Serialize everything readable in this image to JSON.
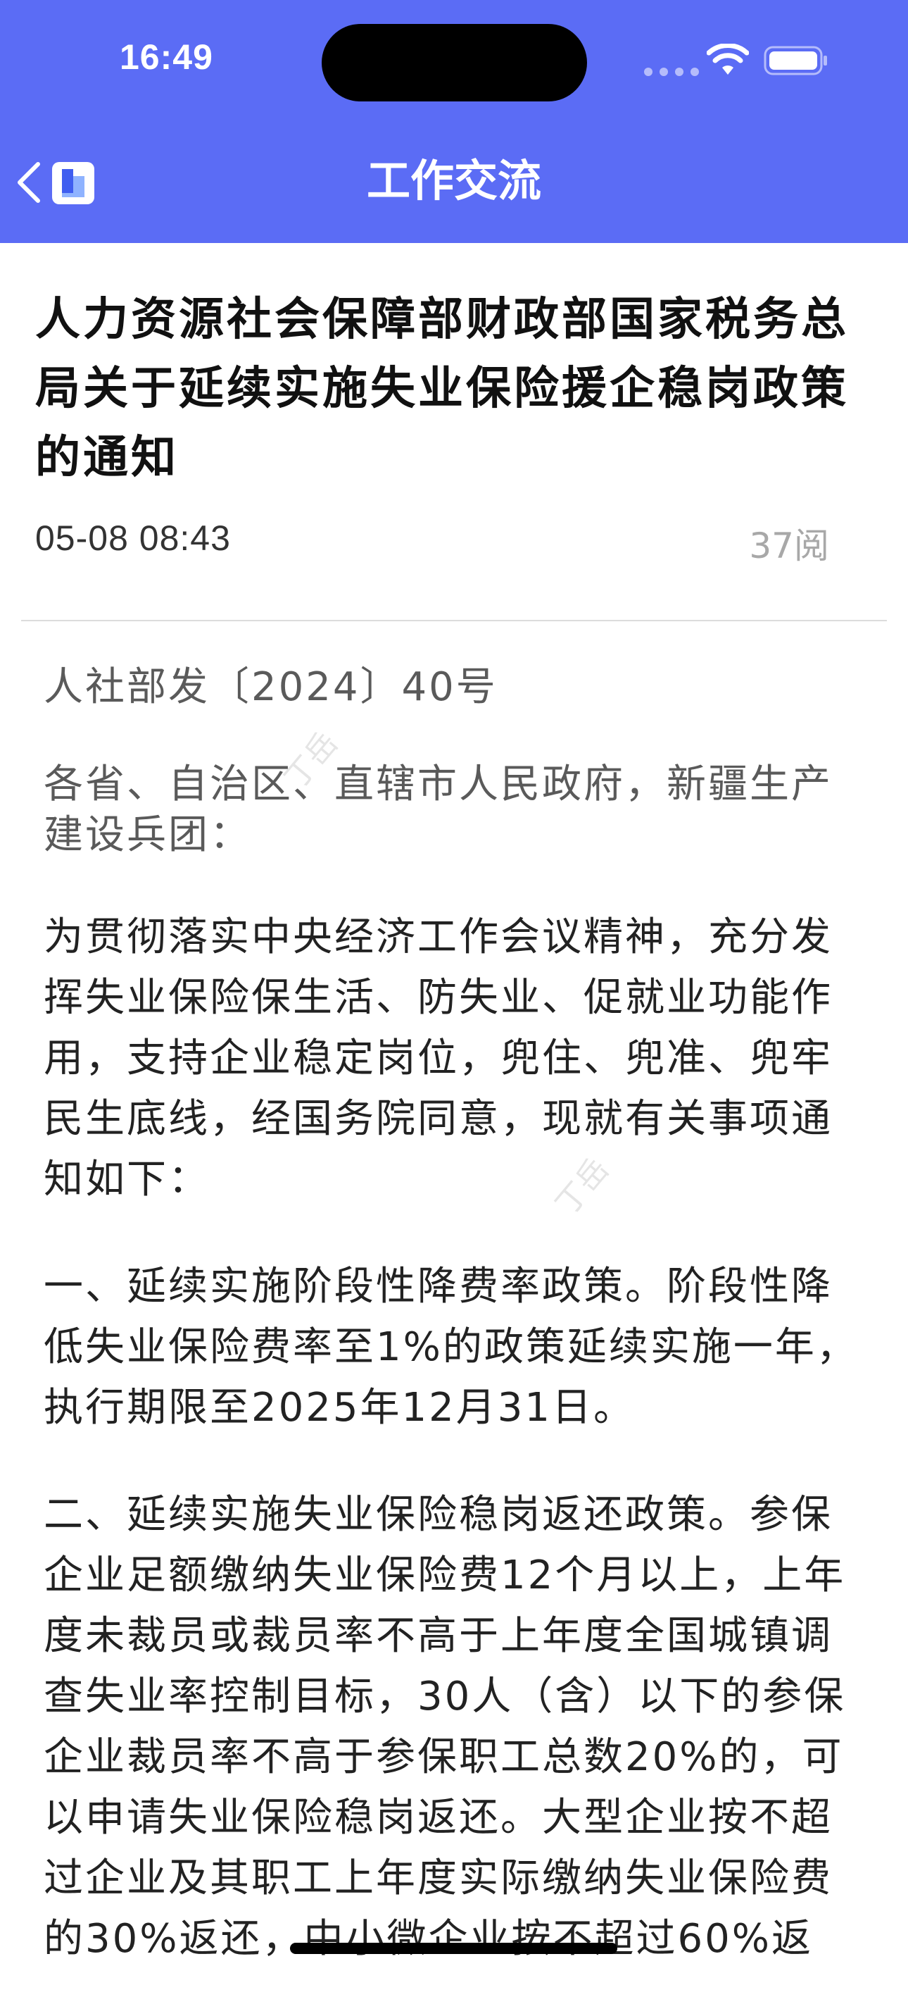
{
  "status_bar": {
    "time": "16:49"
  },
  "nav": {
    "title": "工作交流"
  },
  "article": {
    "title": "人力资源社会保障部财政部国家税务总局关于延续实施失业保险援企稳岗政策的通知",
    "date": "05-08 08:43",
    "reads": "37阅",
    "doc_number": "人社部发〔2024〕40号",
    "addressee": "各省、自治区、直辖市人民政府，新疆生产建设兵团：",
    "paragraphs": [
      "为贯彻落实中央经济工作会议精神，充分发挥失业保险保生活、防失业、促就业功能作用，支持企业稳定岗位，兜住、兜准、兜牢民生底线，经国务院同意，现就有关事项通知如下：",
      "一、延续实施阶段性降费率政策。阶段性降低失业保险费率至1%的政策延续实施一年，执行期限至2025年12月31日。",
      "二、延续实施失业保险稳岗返还政策。参保企业足额缴纳失业保险费12个月以上，上年度未裁员或裁员率不高于上年度全国城镇调查失业率控制目标，30人（含）以下的参保企业裁员率不高于参保职工总数20%的，可以申请失业保险稳岗返还。大型企业按不超过企业及其职工上年度实际缴纳失业保险费的30%返还，中小微企业按不超过60%返"
    ]
  },
  "watermark": {
    "text": "丁岳"
  },
  "colors": {
    "header_bg": "#5b6cf5",
    "text_primary": "#111111",
    "text_muted": "#a8a8a8"
  }
}
